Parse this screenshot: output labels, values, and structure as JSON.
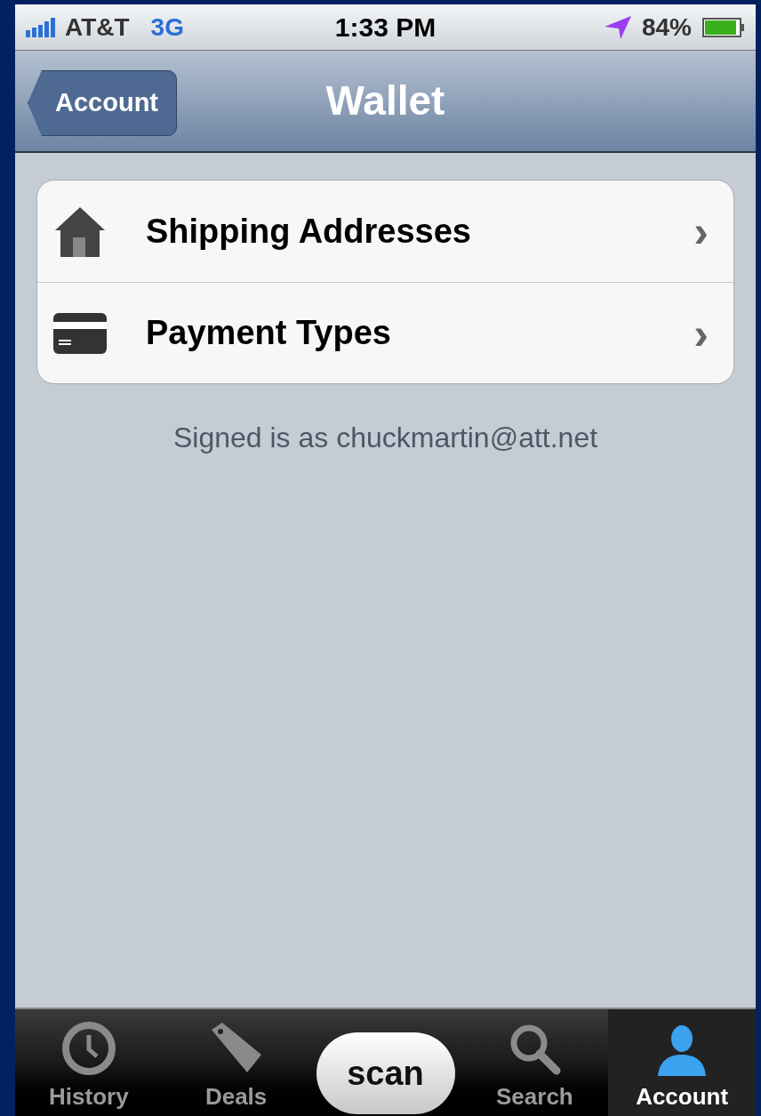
{
  "status_bar": {
    "carrier": "AT&T",
    "network": "3G",
    "time": "1:33 PM",
    "battery": "84%"
  },
  "nav_bar": {
    "back": "Account",
    "title": "Wallet"
  },
  "menu": [
    {
      "label": "Shipping Addresses",
      "chevron": "›"
    },
    {
      "label": "Payment Types",
      "chevron": "›"
    }
  ],
  "signed_in_text": "Signed is as chuckmartin@att.net",
  "tab_bar": [
    {
      "kind": "tab",
      "label": "History",
      "selected": false
    },
    {
      "kind": "tab",
      "label": "Deals",
      "selected": false
    },
    {
      "kind": "scan",
      "label": "scan"
    },
    {
      "kind": "tab",
      "label": "Search",
      "selected": false
    },
    {
      "kind": "tab",
      "label": "Account",
      "selected": true
    }
  ]
}
